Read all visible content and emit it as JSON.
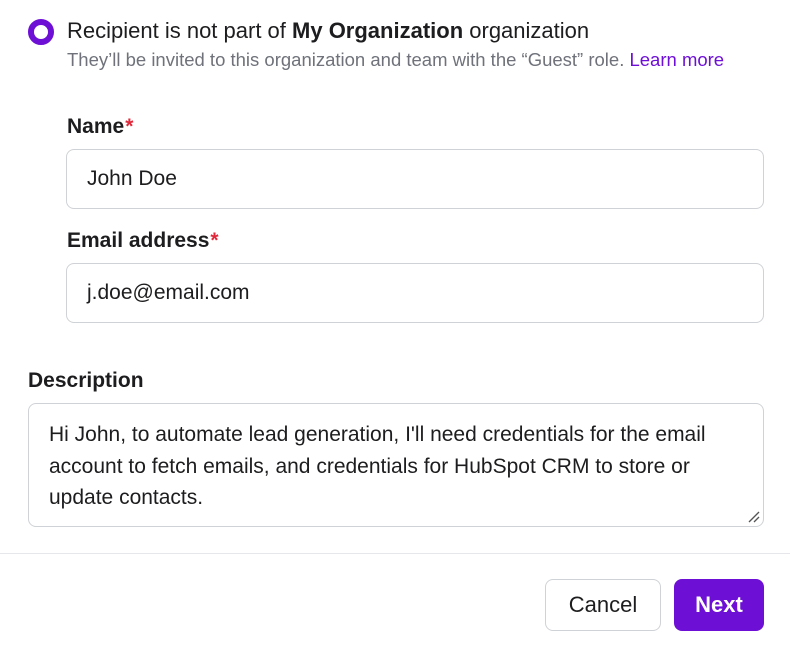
{
  "recipient": {
    "label_prefix": "Recipient is not part of ",
    "org_name": "My Organization",
    "label_suffix": " organization",
    "help_text": "They’ll be invited to this organization and team with the “Guest” role. ",
    "learn_more": "Learn more",
    "selected": true
  },
  "name_field": {
    "label": "Name",
    "required_mark": "*",
    "value": "John Doe"
  },
  "email_field": {
    "label": "Email address",
    "required_mark": "*",
    "value": "j.doe@email.com"
  },
  "description_field": {
    "label": "Description",
    "value": "Hi John, to automate lead generation, I'll need credentials for the email account to fetch emails, and credentials for HubSpot CRM to store or update contacts."
  },
  "footer": {
    "cancel_label": "Cancel",
    "next_label": "Next"
  },
  "colors": {
    "accent": "#6e0fd6",
    "required": "#e0293b",
    "muted_text": "#6f727a",
    "border": "#cfd2d6"
  }
}
